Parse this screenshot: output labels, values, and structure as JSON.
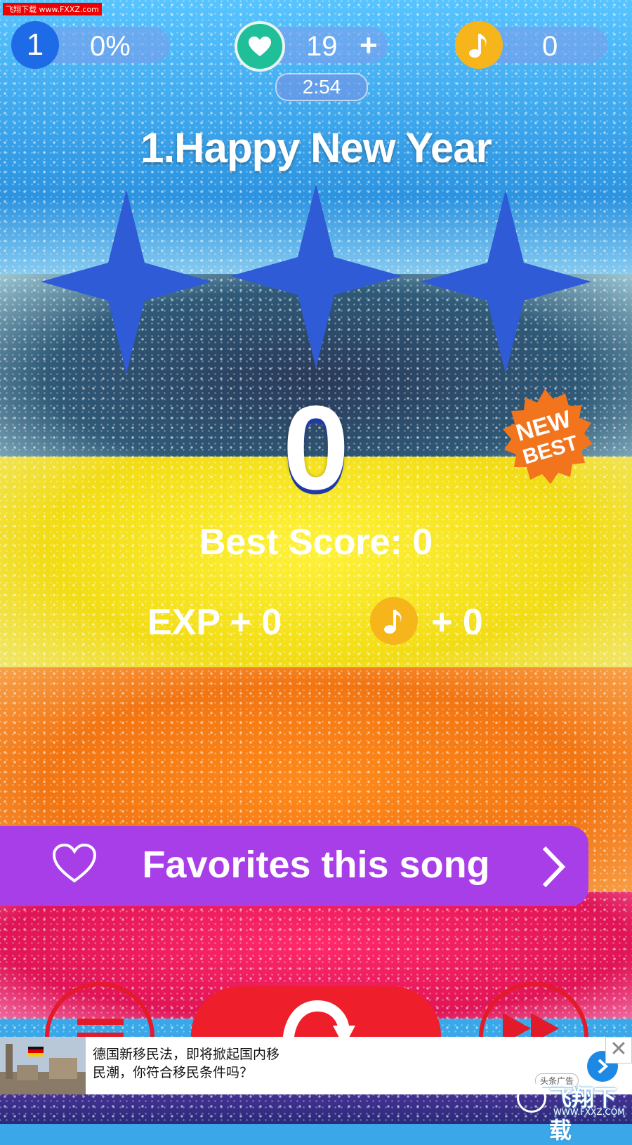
{
  "hud": {
    "level": "1",
    "progress": "0%",
    "lives": "19",
    "lives_add": "+",
    "coins": "0",
    "timer": "2:54"
  },
  "song": {
    "title": "1.Happy New Year",
    "stars_earned": 3
  },
  "result": {
    "score": "0",
    "badge_line1": "NEW",
    "badge_line2": "BEST",
    "best_score": "Best Score: 0",
    "exp": "EXP + 0",
    "coin_reward": "+ 0"
  },
  "favorite": {
    "label": "Favorites this song"
  },
  "ad": {
    "line1": "德国新移民法，即将掀起国内移",
    "line2": "民潮，你符合移民条件吗？",
    "tag": "头条广告",
    "close": "✕"
  },
  "watermark": {
    "top": "飞翔下载 www.FXXZ.com",
    "bottom_big": "飞翔下载",
    "bottom_small": "WWW.FXXZ.COM"
  },
  "colors": {
    "star": "#2f5bd6",
    "fav_bar": "#a83ee8",
    "coin": "#f7b51c",
    "level": "#1e6be8",
    "heart": "#1fbf9a",
    "badge": "#f2741c",
    "action_red": "#ee1f2a"
  },
  "icons": [
    "heart-icon",
    "music-note-icon",
    "heart-outline-icon",
    "chevron-right-icon",
    "menu-icon",
    "replay-icon",
    "skip-icon",
    "arrow-right-icon",
    "close-icon"
  ]
}
